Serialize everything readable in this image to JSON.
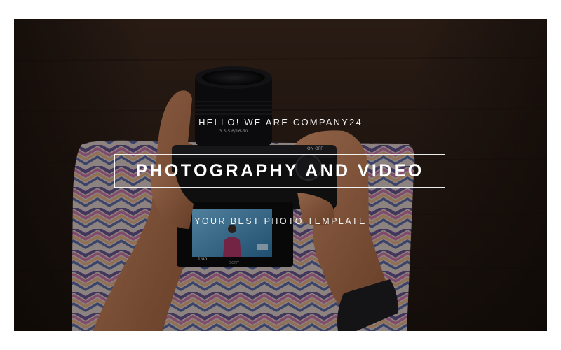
{
  "hero": {
    "kicker": "HELLO! WE ARE COMPANY24",
    "title": "PHOTOGRAPHY AND VIDEO",
    "subtitle": "YOUR BEST PHOTO TEMPLATE"
  },
  "photo": {
    "description_icon": "camera-photo-icon",
    "lens_text": "3.5-5.6/16-50",
    "switch_label": "ON OFF",
    "brand_text": "SONY",
    "screen_readout": "1/80"
  },
  "colors": {
    "background": "#ffffff",
    "hero_dark": "#2b1d16",
    "text": "#ffffff"
  }
}
